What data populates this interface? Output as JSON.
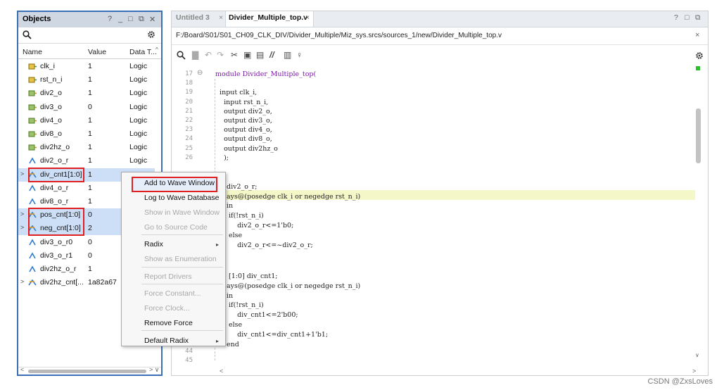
{
  "objects_panel": {
    "title": "Objects",
    "controls": [
      "?",
      "_",
      "□",
      "⧉",
      "✕"
    ],
    "columns": [
      "Name",
      "Value",
      "Data T..."
    ],
    "rows": [
      {
        "name": "clk_i",
        "value": "1",
        "type": "Logic",
        "icon": "port-in-icon"
      },
      {
        "name": "rst_n_i",
        "value": "1",
        "type": "Logic",
        "icon": "port-in-icon"
      },
      {
        "name": "div2_o",
        "value": "1",
        "type": "Logic",
        "icon": "port-out-icon"
      },
      {
        "name": "div3_o",
        "value": "0",
        "type": "Logic",
        "icon": "port-out-icon"
      },
      {
        "name": "div4_o",
        "value": "1",
        "type": "Logic",
        "icon": "port-out-icon"
      },
      {
        "name": "div8_o",
        "value": "1",
        "type": "Logic",
        "icon": "port-out-icon"
      },
      {
        "name": "div2hz_o",
        "value": "1",
        "type": "Logic",
        "icon": "port-out-icon"
      },
      {
        "name": "div2_o_r",
        "value": "1",
        "type": "Logic",
        "icon": "signal-icon"
      },
      {
        "name": "div_cnt1[1:0]",
        "value": "1",
        "type": "",
        "icon": "bus-icon",
        "expander": ">",
        "selected": true,
        "boxed": true
      },
      {
        "name": "div4_o_r",
        "value": "1",
        "type": "",
        "icon": "signal-icon"
      },
      {
        "name": "div8_o_r",
        "value": "1",
        "type": "",
        "icon": "signal-icon"
      },
      {
        "name": "pos_cnt[1:0]",
        "value": "0",
        "type": "",
        "icon": "bus-icon",
        "expander": ">",
        "selected": true,
        "boxed": true
      },
      {
        "name": "neg_cnt[1:0]",
        "value": "2",
        "type": "",
        "icon": "bus-icon",
        "expander": ">",
        "selected": true,
        "boxed": true
      },
      {
        "name": "div3_o_r0",
        "value": "0",
        "type": "",
        "icon": "signal-icon"
      },
      {
        "name": "div3_o_r1",
        "value": "0",
        "type": "",
        "icon": "signal-icon"
      },
      {
        "name": "div2hz_o_r",
        "value": "1",
        "type": "",
        "icon": "signal-icon"
      },
      {
        "name": "div2hz_cnt[...",
        "value": "1a82a67",
        "type": "",
        "icon": "bus-icon",
        "expander": ">"
      }
    ]
  },
  "editor": {
    "tabs": [
      {
        "label": "Untitled 3",
        "active": false
      },
      {
        "label": "Divider_Multiple_top.v",
        "active": true
      }
    ],
    "path": "F:/Board/S01/S01_CH09_CLK_DIV/Divider_Multiple/Miz_sys.srcs/sources_1/new/Divider_Multiple_top.v",
    "window_controls": [
      "?",
      "□",
      "⧉"
    ],
    "lines": [
      {
        "n": "17",
        "text": "module Divider_Multiple_top("
      },
      {
        "n": "18",
        "text": ""
      },
      {
        "n": "19",
        "text": "  input clk_i,"
      },
      {
        "n": "20",
        "text": "    input rst_n_i,"
      },
      {
        "n": "21",
        "text": "    output div2_o,"
      },
      {
        "n": "22",
        "text": "    output div3_o,"
      },
      {
        "n": "23",
        "text": "    output div4_o,"
      },
      {
        "n": "24",
        "text": "    output div8_o,"
      },
      {
        "n": "25",
        "text": "    output div2hz_o"
      },
      {
        "n": "26",
        "text": "    );"
      }
    ],
    "visible_code": [
      "div2_o_r;",
      "ays@(posedge clk_i or negedge rst_n_i)",
      "in",
      " if(!rst_n_i)",
      "     div2_o_r<=1'b0;",
      " else",
      "     div2_o_r<=~div2_o_r;",
      " [1:0] div_cnt1;",
      "ays@(posedge clk_i or negedge rst_n_i)",
      "in",
      " if(!rst_n_i)",
      "     div_cnt1<=2'b00;",
      " else",
      "     div_cnt1<=div_cnt1+1'b1;",
      "end"
    ],
    "bottom_lines": [
      "44",
      "45"
    ]
  },
  "context_menu": {
    "items": [
      {
        "label": "Add to Wave Window",
        "enabled": true,
        "highlight": true
      },
      {
        "label": "Log to Wave Database",
        "enabled": true
      },
      {
        "label": "Show in Wave Window",
        "enabled": false
      },
      {
        "label": "Go to Source Code",
        "enabled": false
      },
      {
        "label": "Radix",
        "enabled": true,
        "submenu": true
      },
      {
        "label": "Show as Enumeration",
        "enabled": false
      },
      {
        "label": "Report Drivers",
        "enabled": false
      },
      {
        "label": "Force Constant...",
        "enabled": false
      },
      {
        "label": "Force Clock...",
        "enabled": false
      },
      {
        "label": "Remove Force",
        "enabled": true
      },
      {
        "label": "Default Radix",
        "enabled": true,
        "submenu": true
      }
    ]
  },
  "watermark": "CSDN @ZxsLoves",
  "colors": {
    "panel_border": "#3b6fb6",
    "selection": "#cddff7",
    "highlight_line": "#f4f7c8",
    "red_box": "#e02020",
    "keyword": "#7a1aa8"
  }
}
